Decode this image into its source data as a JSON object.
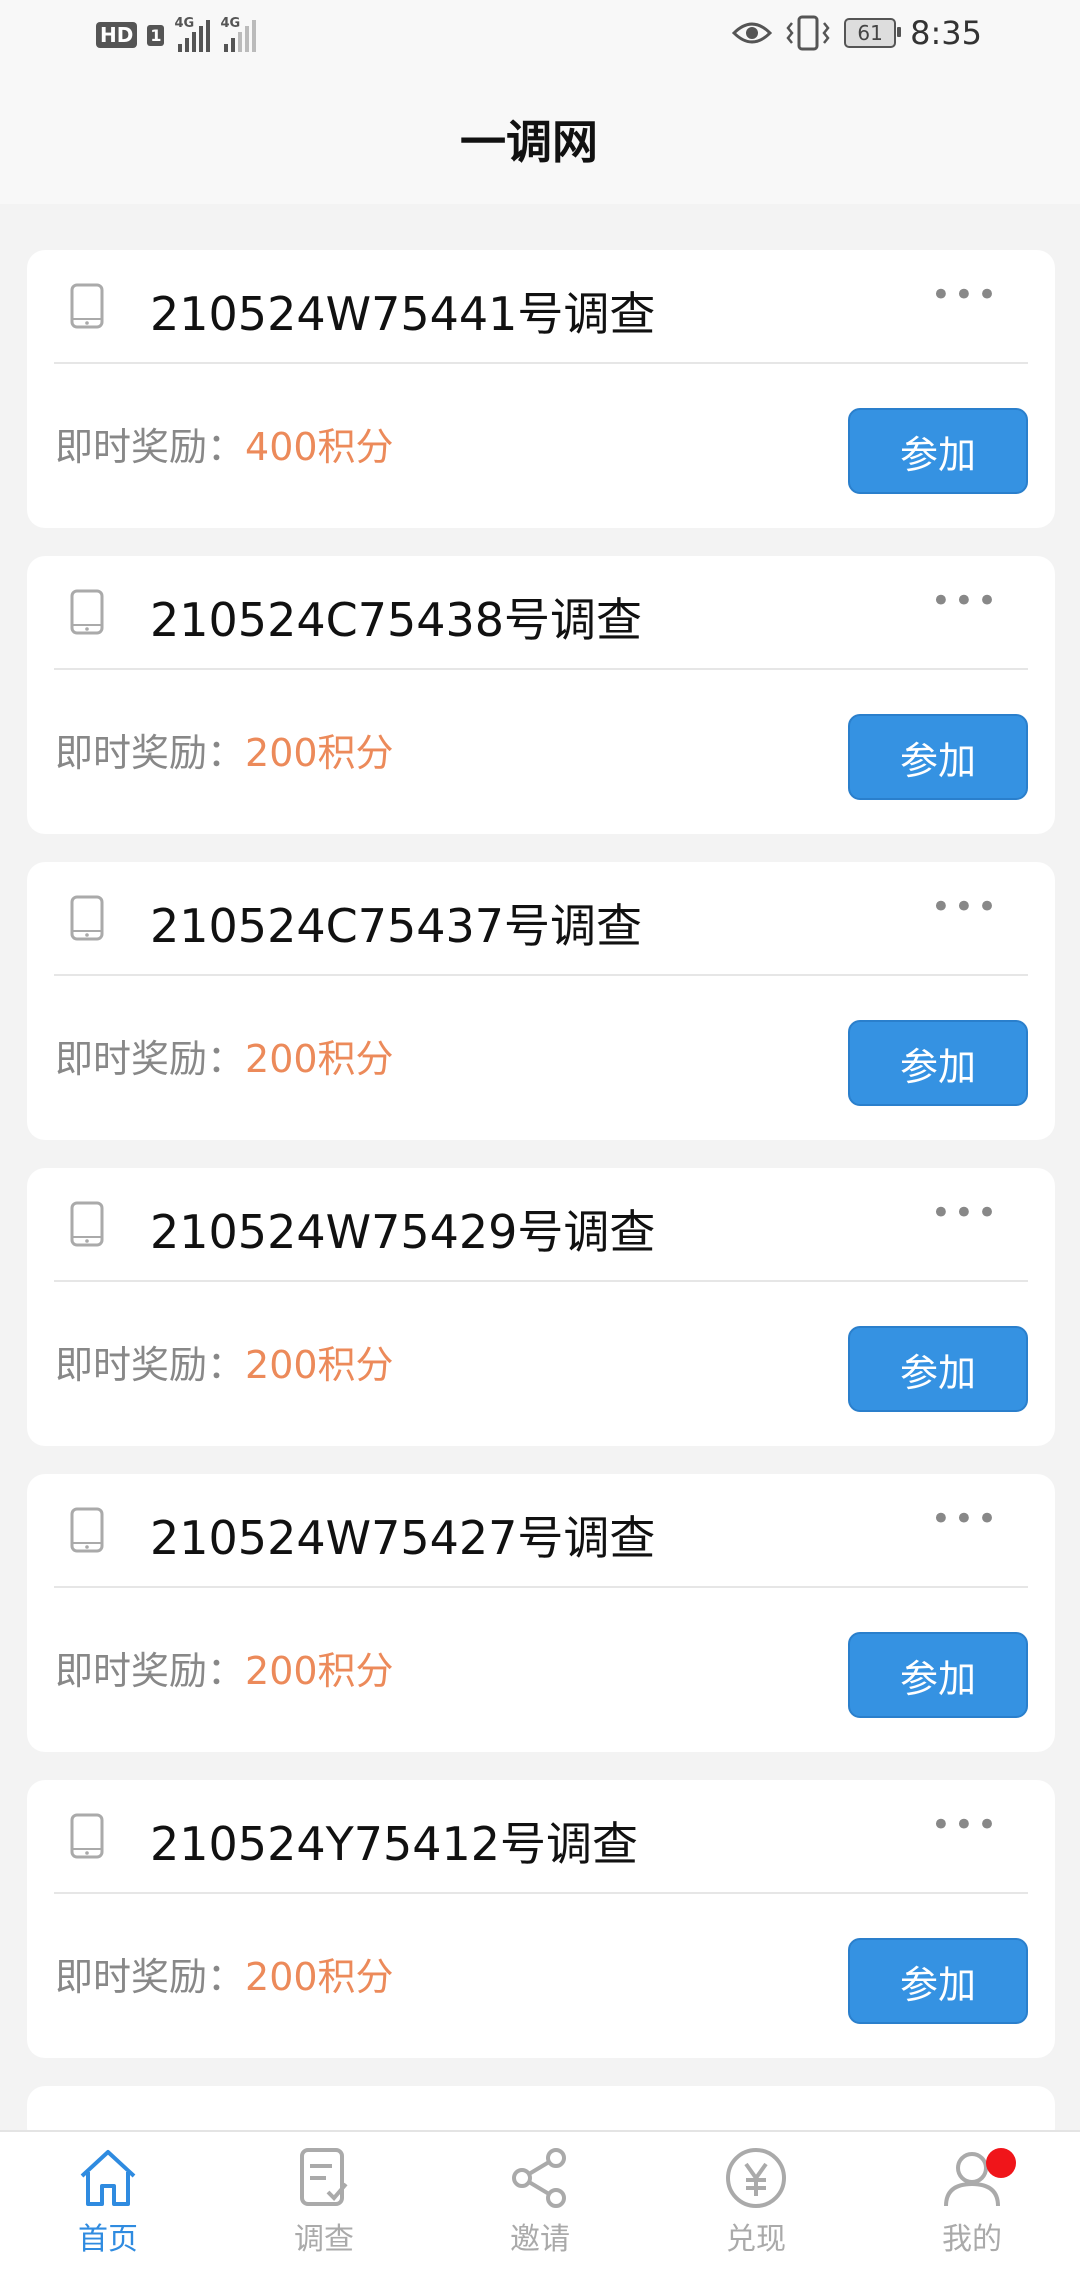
{
  "status_bar": {
    "hd_label": "HD",
    "sim_label": "1",
    "network_1": "4G",
    "network_2": "4G",
    "battery": "61",
    "time": "8:35"
  },
  "header": {
    "title": "一调网"
  },
  "reward_label": "即时奖励：",
  "join_label": "参加",
  "surveys": [
    {
      "title": "210524W75441号调查",
      "reward": "400积分"
    },
    {
      "title": "210524C75438号调查",
      "reward": "200积分"
    },
    {
      "title": "210524C75437号调查",
      "reward": "200积分"
    },
    {
      "title": "210524W75429号调查",
      "reward": "200积分"
    },
    {
      "title": "210524W75427号调查",
      "reward": "200积分"
    },
    {
      "title": "210524Y75412号调查",
      "reward": "200积分"
    }
  ],
  "nav": [
    {
      "label": "首页",
      "icon": "home-icon",
      "active": true
    },
    {
      "label": "调查",
      "icon": "survey-icon",
      "active": false
    },
    {
      "label": "邀请",
      "icon": "share-icon",
      "active": false
    },
    {
      "label": "兑现",
      "icon": "yen-icon",
      "active": false
    },
    {
      "label": "我的",
      "icon": "user-icon",
      "active": false,
      "badge": true
    }
  ],
  "colors": {
    "accent": "#3592e2",
    "reward": "#ec8a5a",
    "nav_active": "#2f8be0",
    "badge": "#f0151a"
  }
}
